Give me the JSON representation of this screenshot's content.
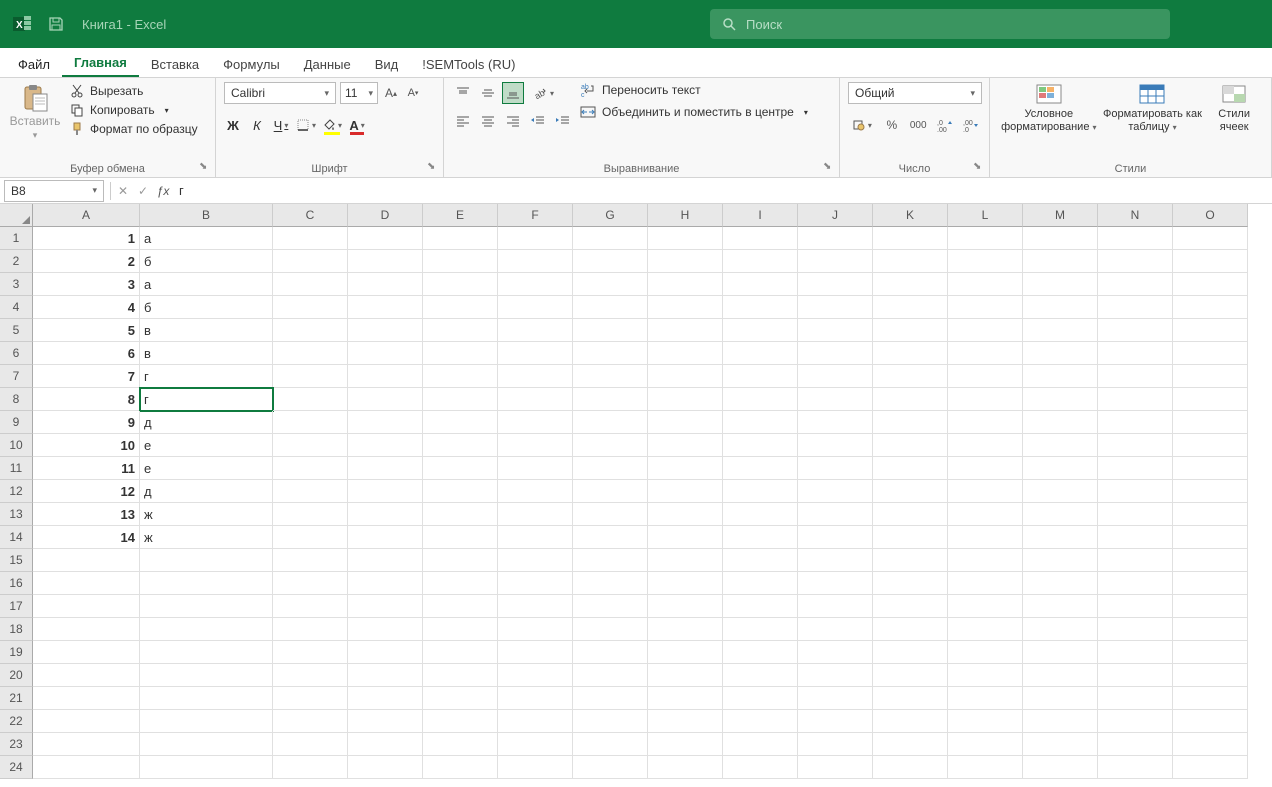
{
  "title": {
    "doc": "Книга1",
    "app": "Excel"
  },
  "search": {
    "placeholder": "Поиск"
  },
  "tabs": {
    "file": "Файл",
    "home": "Главная",
    "insert": "Вставка",
    "formulas": "Формулы",
    "data": "Данные",
    "view": "Вид",
    "semtools": "!SEMTools (RU)"
  },
  "ribbon": {
    "clipboard": {
      "paste": "Вставить",
      "cut": "Вырезать",
      "copy": "Копировать",
      "format_painter": "Формат по образцу",
      "group": "Буфер обмена"
    },
    "font": {
      "name": "Calibri",
      "size": "11",
      "bold": "Ж",
      "italic": "К",
      "underline": "Ч",
      "group": "Шрифт"
    },
    "align": {
      "wrap": "Переносить текст",
      "merge": "Объединить и поместить в центре",
      "group": "Выравнивание"
    },
    "number": {
      "format": "Общий",
      "group": "Число"
    },
    "styles": {
      "cond": "Условное форматирование",
      "table": "Форматировать как таблицу",
      "cell": "Стили ячеек",
      "group": "Стили"
    }
  },
  "formula_bar": {
    "cell_ref": "B8",
    "value": "г"
  },
  "columns": [
    "A",
    "B",
    "C",
    "D",
    "E",
    "F",
    "G",
    "H",
    "I",
    "J",
    "K",
    "L",
    "M",
    "N",
    "O"
  ],
  "row_count": 24,
  "data_rows": [
    {
      "a": "1",
      "b": "а"
    },
    {
      "a": "2",
      "b": "б"
    },
    {
      "a": "3",
      "b": "а"
    },
    {
      "a": "4",
      "b": "б"
    },
    {
      "a": "5",
      "b": "в"
    },
    {
      "a": "6",
      "b": "в"
    },
    {
      "a": "7",
      "b": "г"
    },
    {
      "a": "8",
      "b": "г"
    },
    {
      "a": "9",
      "b": "д"
    },
    {
      "a": "10",
      "b": "е"
    },
    {
      "a": "11",
      "b": "е"
    },
    {
      "a": "12",
      "b": "д"
    },
    {
      "a": "13",
      "b": "ж"
    },
    {
      "a": "14",
      "b": "ж"
    }
  ],
  "selected_cell": {
    "row": 8,
    "col": "B"
  }
}
